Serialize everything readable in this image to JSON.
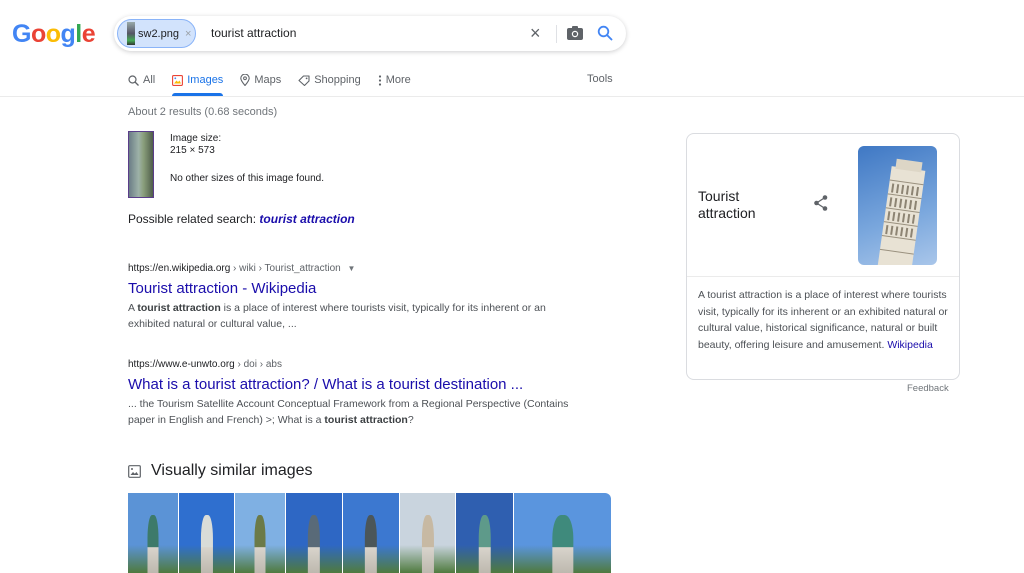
{
  "logo": {
    "letters": [
      "G",
      "o",
      "o",
      "g",
      "l",
      "e"
    ],
    "colors": [
      "#4285f4",
      "#ea4335",
      "#fbbc05",
      "#4285f4",
      "#34a853",
      "#ea4335"
    ]
  },
  "search": {
    "image_chip_label": "sw2.png",
    "image_chip_remove": "×",
    "query": "tourist attraction",
    "clear_icon": "×"
  },
  "tabs": [
    {
      "label": "All",
      "icon": "search-icon",
      "active": false
    },
    {
      "label": "Images",
      "icon": "image-icon",
      "active": true
    },
    {
      "label": "Maps",
      "icon": "map-pin-icon",
      "active": false
    },
    {
      "label": "Shopping",
      "icon": "tag-icon",
      "active": false
    },
    {
      "label": "More",
      "icon": "more-vert-icon",
      "active": false
    }
  ],
  "tools_label": "Tools",
  "stats": "About 2 results (0.68 seconds)",
  "query_image": {
    "size_label": "Image size:",
    "size_value": "215 × 573",
    "no_other_sizes": "No other sizes of this image found."
  },
  "related": {
    "prefix": "Possible related search: ",
    "link": "tourist attraction"
  },
  "results": [
    {
      "url_host": "https://en.wikipedia.org",
      "url_path": " › wiki › Tourist_attraction",
      "has_dropdown": true,
      "title": "Tourist attraction - Wikipedia",
      "snippet_pre": "A ",
      "snippet_bold": "tourist attraction",
      "snippet_post": " is a place of interest where tourists visit, typically for its inherent or an exhibited natural or cultural value, ..."
    },
    {
      "url_host": "https://www.e-unwto.org",
      "url_path": " › doi › abs",
      "has_dropdown": false,
      "title": "What is a tourist attraction? / What is a tourist destination ...",
      "snippet_pre": "... the Tourism Satellite Account Conceptual Framework from a Regional Perspective (Contains paper in English and French) >; What is a ",
      "snippet_bold": "tourist attraction",
      "snippet_post": "?"
    }
  ],
  "similar": {
    "heading": "Visually similar images",
    "thumbs": [
      {
        "sky": "#5b93d6",
        "figure": "#3d7a6a"
      },
      {
        "sky": "#2f6fcf",
        "figure": "#d9dcd8"
      },
      {
        "sky": "#7fb0e3",
        "figure": "#6b7a48"
      },
      {
        "sky": "#2e67c4",
        "figure": "#596a78"
      },
      {
        "sky": "#3c78d0",
        "figure": "#4b5659"
      },
      {
        "sky": "#c9d4de",
        "figure": "#c7b9a3"
      },
      {
        "sky": "#2f5fb0",
        "figure": "#5e9a8a"
      },
      {
        "sky": "#5a95de",
        "figure": "#3f8a7c"
      }
    ]
  },
  "knowledge_panel": {
    "title": "Tourist attraction",
    "description": "A tourist attraction is a place of interest where tourists visit, typically for its inherent or an exhibited natural or cultural value, historical significance, natural or built beauty, offering leisure and amusement. ",
    "source_link": "Wikipedia",
    "feedback": "Feedback"
  }
}
